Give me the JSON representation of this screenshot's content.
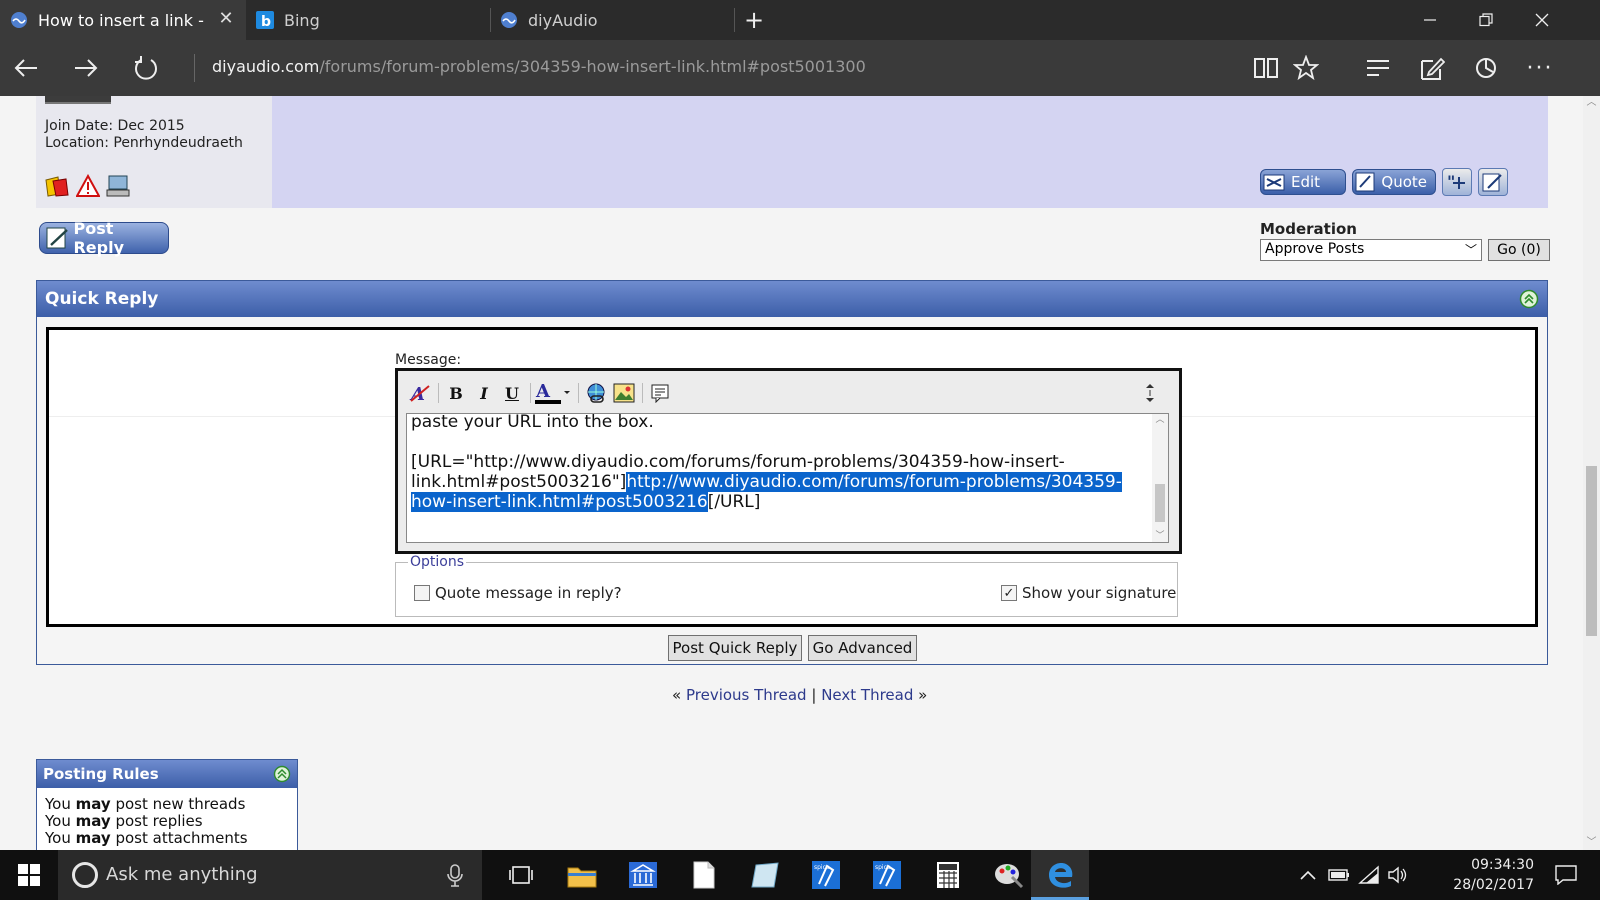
{
  "browser": {
    "tabs": [
      {
        "label": "How to insert a link - di",
        "active": true,
        "icon": "diyaudio-icon"
      },
      {
        "label": "Bing",
        "active": false,
        "icon": "bing-icon"
      },
      {
        "label": "diyAudio",
        "active": false,
        "icon": "diyaudio-icon"
      }
    ],
    "url_host": "diyaudio.com",
    "url_path": "/forums/forum-problems/304359-how-insert-link.html#post5001300"
  },
  "post": {
    "join_date": "Join Date: Dec 2015",
    "location": "Location: Penrhyndeudraeth",
    "edit_label": "Edit",
    "quote_label": "Quote"
  },
  "post_reply_label": "Post Reply",
  "moderation": {
    "title": "Moderation",
    "selected": "Approve Posts",
    "go_label": "Go (0)"
  },
  "quick_reply": {
    "title": "Quick Reply",
    "message_label": "Message:",
    "lines": {
      "l1": "paste your URL into the box.",
      "l2": "[URL=\"http://www.diyaudio.com/forums/forum-problems/304359-how-insert-",
      "l3a": "link.html#post5003216\"]",
      "l3b": "http://www.diyaudio.com/forums/forum-problems/304359-",
      "l4a": "how-insert-link.html#post5003216",
      "l4b": "[/URL]"
    },
    "options_legend": "Options",
    "quote_option": "Quote message in reply?",
    "quote_checked": false,
    "signature_option": "Show your signature",
    "signature_checked": true,
    "submit_label": "Post Quick Reply",
    "advanced_label": "Go Advanced"
  },
  "thread_nav": {
    "prev_marker": "«",
    "prev": "Previous Thread",
    "separator": "|",
    "next": "Next Thread",
    "next_marker": "»"
  },
  "posting_rules": {
    "title": "Posting Rules",
    "rows": [
      {
        "pre": "You ",
        "em": "may",
        "post": " post new threads"
      },
      {
        "pre": "You ",
        "em": "may",
        "post": " post replies"
      },
      {
        "pre": "You ",
        "em": "may",
        "post": " post attachments"
      }
    ]
  },
  "taskbar": {
    "search_placeholder": "Ask me anything",
    "time": "09:34:30",
    "date": "28/02/2017"
  },
  "colors": {
    "accent_blue": "#3c5ea8",
    "selection": "#0a64cc",
    "post_strip": "#d4d4f2"
  }
}
